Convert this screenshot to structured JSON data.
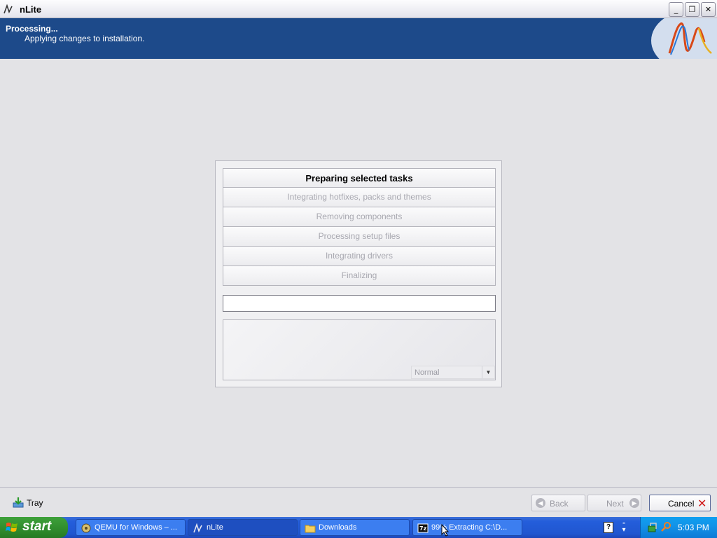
{
  "window": {
    "title": "nLite",
    "minimize_glyph": "_",
    "restore_glyph": "❐",
    "close_glyph": "✕"
  },
  "header": {
    "title": "Processing...",
    "subtitle": "Applying changes to installation."
  },
  "tasks": [
    {
      "label": "Preparing selected tasks",
      "active": true
    },
    {
      "label": "Integrating hotfixes, packs and themes",
      "active": false
    },
    {
      "label": "Removing components",
      "active": false
    },
    {
      "label": "Processing setup files",
      "active": false
    },
    {
      "label": "Integrating drivers",
      "active": false
    },
    {
      "label": "Finalizing",
      "active": false
    }
  ],
  "progress": {
    "value": 0
  },
  "log": {
    "priority_select": {
      "value": "Normal"
    }
  },
  "bottom_bar": {
    "tray_label": "Tray",
    "back_label": "Back",
    "next_label": "Next",
    "cancel_label": "Cancel"
  },
  "taskbar": {
    "start_label": "start",
    "items": [
      {
        "label": "QEMU for Windows – ...",
        "icon": "qemu-icon",
        "active": false
      },
      {
        "label": "nLite",
        "icon": "nlite-icon",
        "active": true
      },
      {
        "label": "Downloads",
        "icon": "folder-icon",
        "active": false
      },
      {
        "label": "99% Extracting C:\\D...",
        "icon": "7zip-icon",
        "active": false
      }
    ],
    "clock": "5:03 PM"
  },
  "colors": {
    "banner": "#1d4a8a",
    "taskbar": "#245edb",
    "start_button": "#2f8b2c",
    "cancel_x": "#d01818"
  }
}
